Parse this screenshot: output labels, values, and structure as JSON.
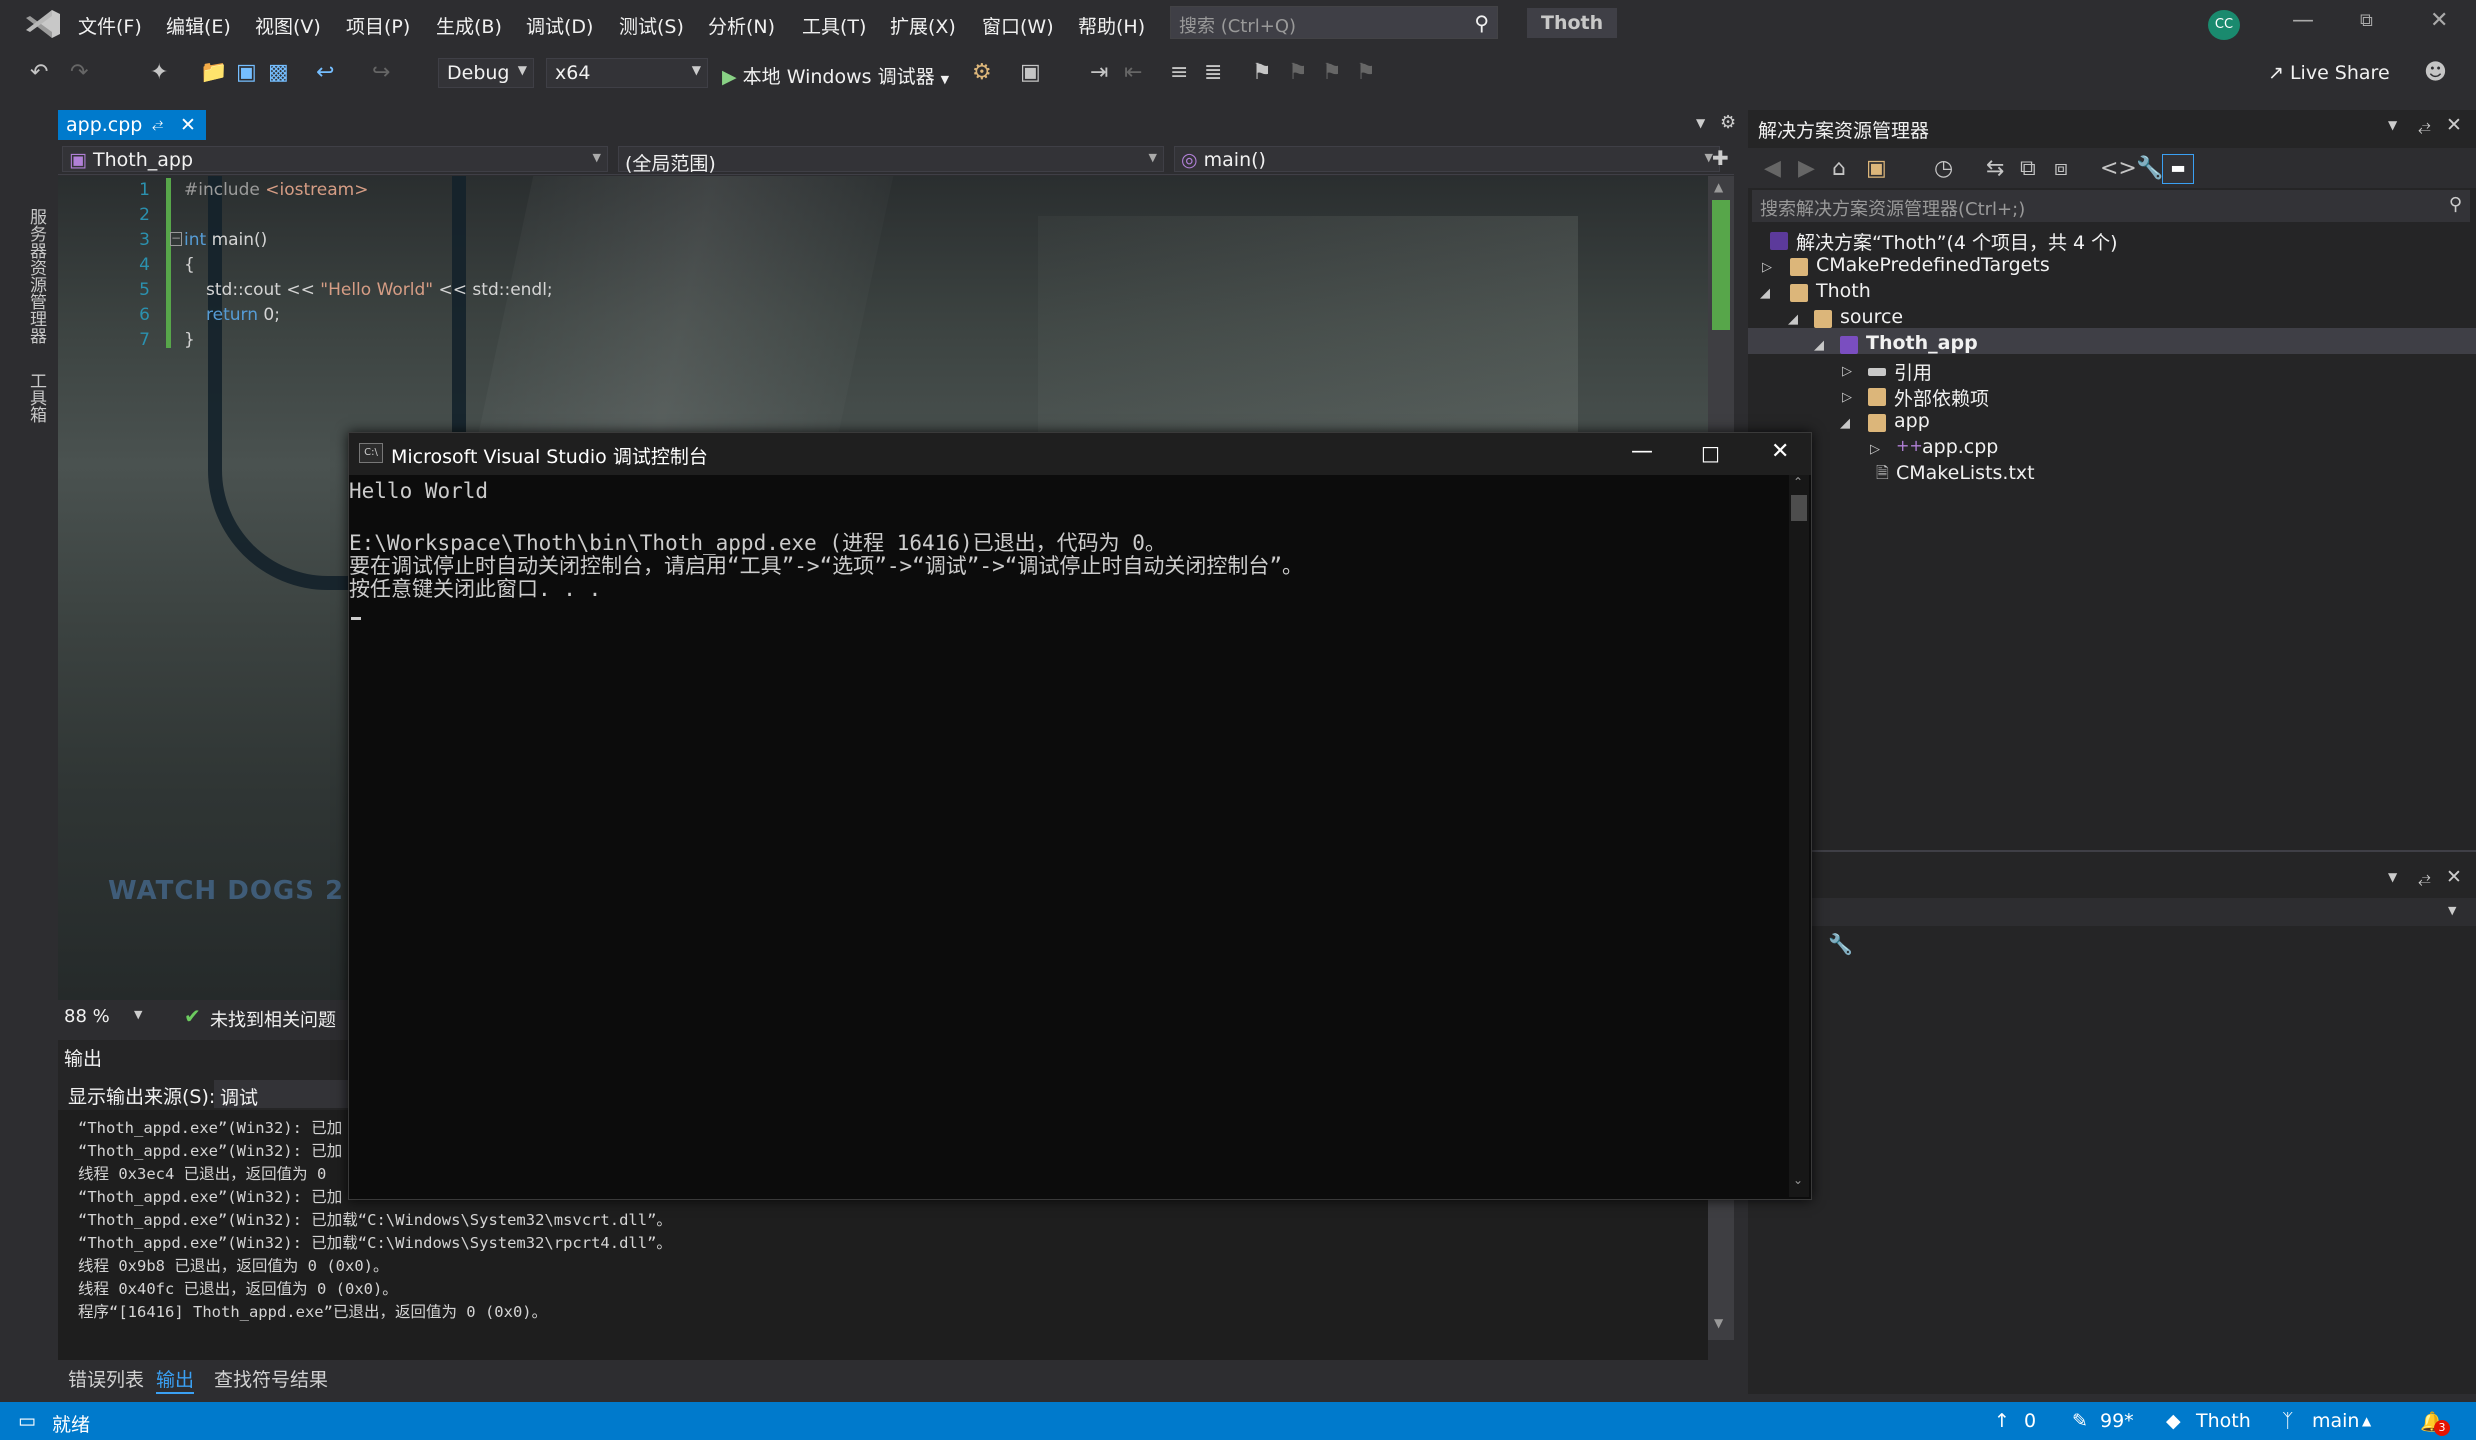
{
  "menu": {
    "items": [
      "文件(F)",
      "编辑(E)",
      "视图(V)",
      "项目(P)",
      "生成(B)",
      "调试(D)",
      "测试(S)",
      "分析(N)",
      "工具(T)",
      "扩展(X)",
      "窗口(W)",
      "帮助(H)"
    ],
    "search_placeholder": "搜索 (Ctrl+Q)",
    "project_name": "Thoth",
    "avatar_initials": "CC"
  },
  "toolbar": {
    "config": "Debug",
    "platform": "x64",
    "run_label": "本地 Windows 调试器",
    "live_share": "Live Share"
  },
  "left_strip": {
    "server_explorer": "服务器资源管理器",
    "toolbox": "工具箱"
  },
  "editor": {
    "tab_label": "app.cpp",
    "nav_project": "Thoth_app",
    "nav_scope": "(全局范围)",
    "nav_member": "main()",
    "lines": [
      {
        "n": "1"
      },
      {
        "n": "2"
      },
      {
        "n": "3"
      },
      {
        "n": "4"
      },
      {
        "n": "5"
      },
      {
        "n": "6"
      },
      {
        "n": "7"
      }
    ],
    "code": {
      "l1_pp": "#include ",
      "l1_inc": "<iostream>",
      "l3_kw": "int",
      "l3_rest": " main()",
      "l4": "{",
      "l5_a": "std::cout << ",
      "l5_str": "\"Hello World\"",
      "l5_b": " << std::endl;",
      "l6_kw": "return",
      "l6_rest": " 0;",
      "l7": "}"
    },
    "zoom": "88 %",
    "issues": "未找到相关问题",
    "watermark": "WATCH DOGS 2"
  },
  "output": {
    "title": "输出",
    "source_label": "显示输出来源(S):",
    "source_value": "调试",
    "lines": [
      "“Thoth_appd.exe”(Win32): 已加",
      "“Thoth_appd.exe”(Win32): 已加",
      "线程 0x3ec4 已退出，返回值为 0",
      "“Thoth_appd.exe”(Win32): 已加",
      "“Thoth_appd.exe”(Win32): 已加载“C:\\Windows\\System32\\msvcrt.dll”。",
      "“Thoth_appd.exe”(Win32): 已加载“C:\\Windows\\System32\\rpcrt4.dll”。",
      "线程 0x9b8 已退出，返回值为 0 (0x0)。",
      "线程 0x40fc 已退出，返回值为 0 (0x0)。",
      "程序“[16416] Thoth_appd.exe”已退出，返回值为 0 (0x0)。"
    ],
    "tabs": [
      "错误列表",
      "输出",
      "查找符号结果"
    ]
  },
  "solution_explorer": {
    "title": "解决方案资源管理器",
    "search_placeholder": "搜索解决方案资源管理器(Ctrl+;)",
    "tree": [
      {
        "label": "解决方案“Thoth”(4 个项目，共 4 个)"
      },
      {
        "label": "CMakePredefinedTargets"
      },
      {
        "label": "Thoth"
      },
      {
        "label": "source"
      },
      {
        "label": "Thoth_app"
      },
      {
        "label": "引用"
      },
      {
        "label": "外部依赖项"
      },
      {
        "label": "app"
      },
      {
        "label": "app.cpp"
      },
      {
        "label": "CMakeLists.txt"
      }
    ]
  },
  "console": {
    "title": "Microsoft Visual Studio 调试控制台",
    "icon_text": "C:\\",
    "lines": [
      "Hello World",
      "",
      "E:\\Workspace\\Thoth\\bin\\Thoth_appd.exe (进程 16416)已退出，代码为 0。",
      "要在调试停止时自动关闭控制台，请启用“工具”->“选项”->“调试”->“调试停止时自动关闭控制台”。",
      "按任意键关闭此窗口. . ."
    ]
  },
  "status_bar": {
    "ready": "就绪",
    "up_count": "0",
    "pencil_count": "99*",
    "repo": "Thoth",
    "branch": "main",
    "notif_count": "3"
  },
  "colors": {
    "accent": "#007acc",
    "background": "#2d2d30",
    "console_bg": "#0c0c0c"
  }
}
